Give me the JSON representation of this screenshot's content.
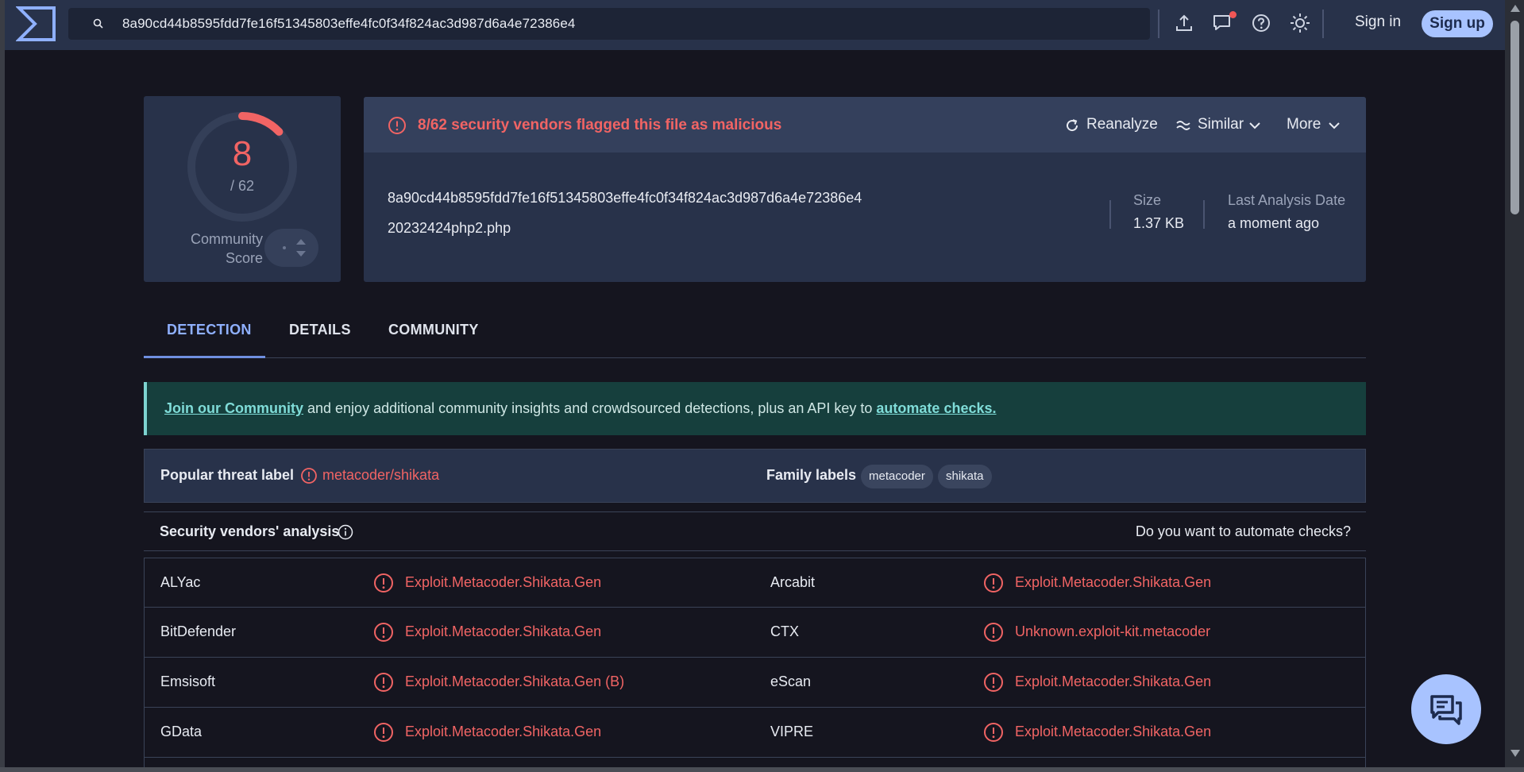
{
  "header": {
    "search_value": "8a90cd44b8595fdd7fe16f51345803effe4fc0f34f824ac3d987d6a4e72386e4",
    "sign_in": "Sign in",
    "sign_up": "Sign up"
  },
  "score": {
    "detections": "8",
    "total": "/ 62",
    "detection_fraction": 0.129,
    "community_label_line1": "Community",
    "community_label_line2": "Score"
  },
  "file": {
    "alert": "8/62 security vendors flagged this file as malicious",
    "reanalyze": "Reanalyze",
    "similar": "Similar",
    "more": "More",
    "hash": "8a90cd44b8595fdd7fe16f51345803effe4fc0f34f824ac3d987d6a4e72386e4",
    "name": "20232424php2.php",
    "size_label": "Size",
    "size_value": "1.37 KB",
    "date_label": "Last Analysis Date",
    "date_value": "a moment ago"
  },
  "tabs": [
    "DETECTION",
    "DETAILS",
    "COMMUNITY"
  ],
  "banner": {
    "link1": "Join our Community",
    "text": " and enjoy additional community insights and crowdsourced detections, plus an API key to ",
    "link2": "automate checks."
  },
  "threat": {
    "popular_label": "Popular threat label",
    "popular_value": "metacoder/shikata",
    "family_label": "Family labels",
    "families": [
      "metacoder",
      "shikata"
    ]
  },
  "vendors": {
    "title": "Security vendors' analysis",
    "automate": "Do you want to automate checks?",
    "rows": [
      {
        "left_vendor": "ALYac",
        "left_result": "Exploit.Metacoder.Shikata.Gen",
        "right_vendor": "Arcabit",
        "right_result": "Exploit.Metacoder.Shikata.Gen"
      },
      {
        "left_vendor": "BitDefender",
        "left_result": "Exploit.Metacoder.Shikata.Gen",
        "right_vendor": "CTX",
        "right_result": "Unknown.exploit-kit.metacoder"
      },
      {
        "left_vendor": "Emsisoft",
        "left_result": "Exploit.Metacoder.Shikata.Gen (B)",
        "right_vendor": "eScan",
        "right_result": "Exploit.Metacoder.Shikata.Gen"
      },
      {
        "left_vendor": "GData",
        "left_result": "Exploit.Metacoder.Shikata.Gen",
        "right_vendor": "VIPRE",
        "right_result": "Exploit.Metacoder.Shikata.Gen"
      }
    ]
  },
  "colors": {
    "accent": "#a8c3ff",
    "malicious": "#f16464",
    "topbar": "#28324a",
    "background": "#15151f",
    "banner": "#163f3d"
  },
  "icons": [
    "logo-icon",
    "search-icon",
    "upload-icon",
    "chat-icon",
    "help-icon",
    "theme-icon",
    "alert-icon",
    "refresh-icon",
    "similar-icon",
    "chevron-down-icon",
    "info-icon",
    "chat-bubble-icon"
  ]
}
